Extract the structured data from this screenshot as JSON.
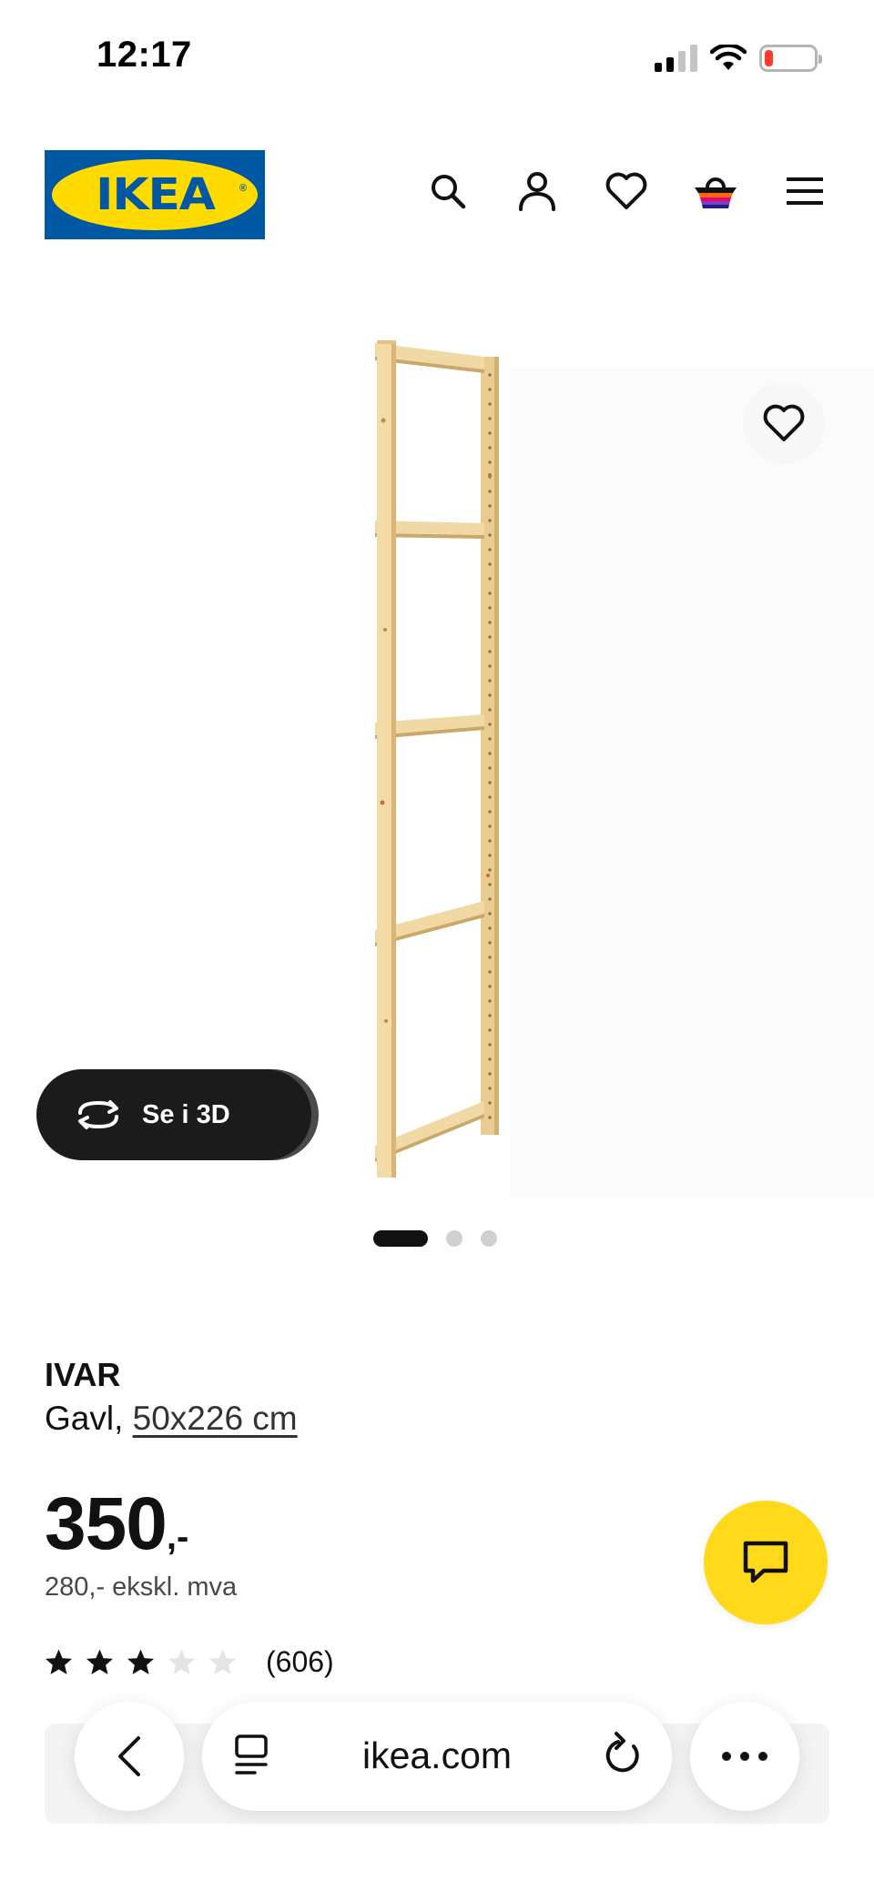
{
  "status_bar": {
    "time": "12:17",
    "battery_level": 0.18,
    "battery_color": "#ff3b30"
  },
  "header": {
    "logo_text": "IKEA",
    "brand_blue": "#0058a3",
    "brand_yellow": "#ffdb00",
    "icons": [
      "search-icon",
      "account-icon",
      "favourites-icon",
      "shopping-bag-icon",
      "menu-icon"
    ]
  },
  "gallery": {
    "view_3d_label": "Se i 3D",
    "page_count": 3,
    "active_page": 1
  },
  "product": {
    "name": "IVAR",
    "type": "Gavl,",
    "size": "50x226 cm",
    "price_integer": "350",
    "price_suffix": ",-",
    "price_ex_vat": "280,- ekskl. mva",
    "rating": 3,
    "rating_max": 5,
    "review_count": "(606)"
  },
  "chat": {
    "accent": "#ffd91a",
    "icon": "chat-icon"
  },
  "browser": {
    "url": "ikea.com",
    "icons": [
      "back-icon",
      "tabs-icon",
      "reload-icon",
      "more-icon"
    ]
  }
}
